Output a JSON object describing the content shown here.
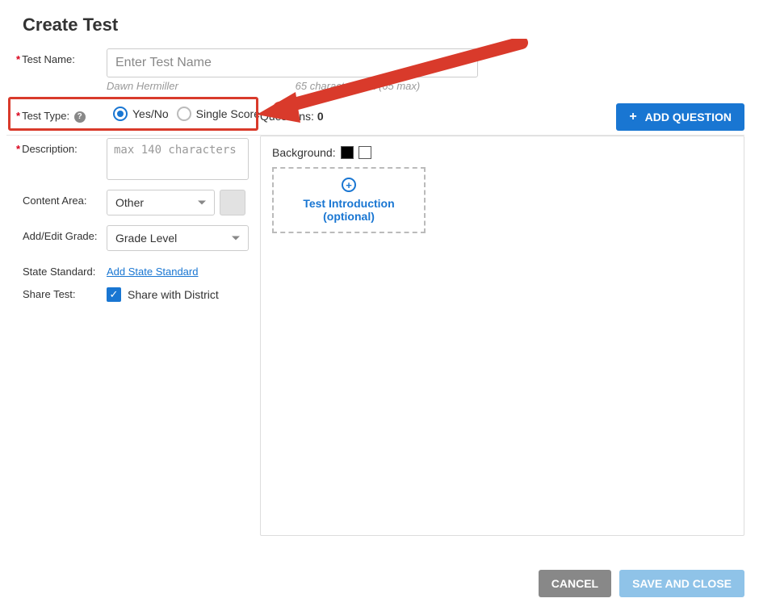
{
  "page": {
    "title": "Create Test"
  },
  "form": {
    "testName": {
      "label": "Test Name:",
      "placeholder": "Enter Test Name",
      "author": "Dawn Hermiller",
      "charsLeft": "65 characters left (65 max)"
    },
    "testType": {
      "label": "Test Type:",
      "options": {
        "yesno": "Yes/No",
        "single": "Single Score"
      }
    },
    "description": {
      "label": "Description:",
      "placeholder": "max 140 characters"
    },
    "contentArea": {
      "label": "Content Area:",
      "value": "Other"
    },
    "grade": {
      "label": "Add/Edit Grade:",
      "value": "Grade Level"
    },
    "stateStandard": {
      "label": "State Standard:",
      "link": "Add State Standard"
    },
    "share": {
      "label": "Share Test:",
      "option": "Share with District"
    }
  },
  "questions": {
    "label": "Questions:",
    "count": "0",
    "addButton": "ADD QUESTION"
  },
  "rightPanel": {
    "backgroundLabel": "Background:",
    "intro": {
      "line1": "Test Introduction",
      "line2": "(optional)"
    }
  },
  "footer": {
    "cancel": "CANCEL",
    "save": "SAVE AND CLOSE"
  }
}
